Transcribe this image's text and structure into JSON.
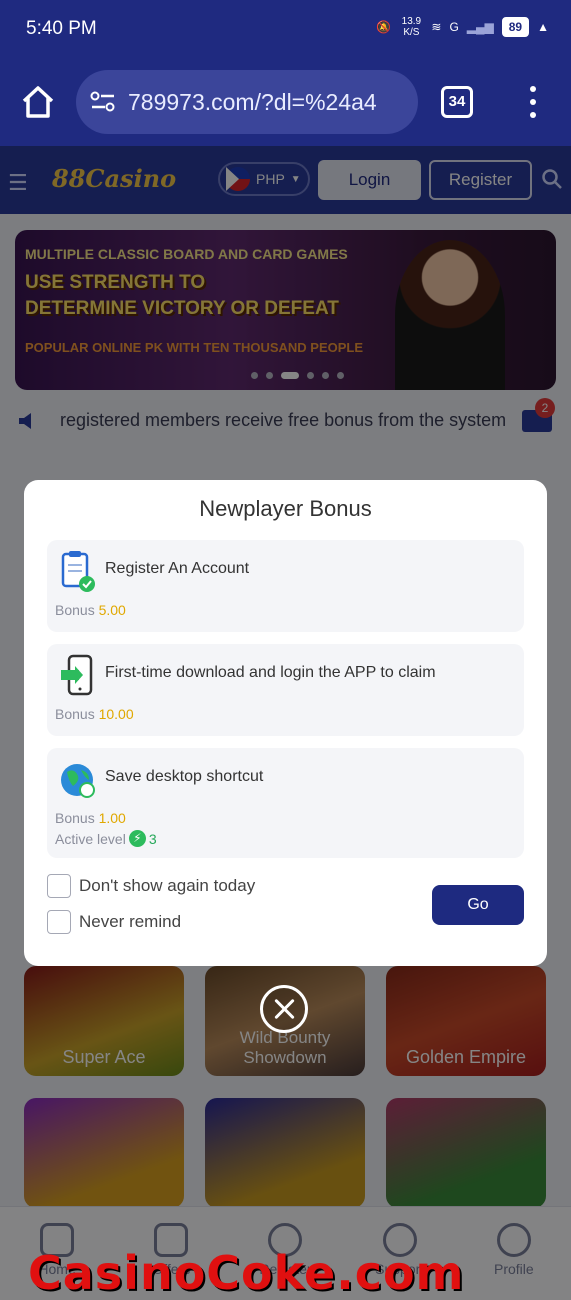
{
  "status_bar": {
    "time": "5:40 PM",
    "net_speed": "13.9 K/S",
    "network": "G",
    "battery": "89"
  },
  "browser": {
    "url": "789973.com/?dl=%24a4",
    "tab_count": "34"
  },
  "site_header": {
    "logo_text": "88Casino",
    "currency": "PHP",
    "login_label": "Login",
    "register_label": "Register"
  },
  "banner": {
    "line1": "MULTIPLE CLASSIC BOARD AND CARD GAMES",
    "line2": "USE STRENGTH TO",
    "line3": "DETERMINE VICTORY OR DEFEAT",
    "line4": "POPULAR ONLINE PK WITH TEN THOUSAND PEOPLE",
    "active_slide": 3,
    "slide_count": 6
  },
  "marquee": {
    "text": "registered members receive free bonus from the system",
    "mail_badge": "2"
  },
  "modal": {
    "title": "Newplayer Bonus",
    "tasks": [
      {
        "name": "Register An Account",
        "bonus_label": "Bonus",
        "bonus_value": "5.00",
        "icon": "clipboard-check-icon"
      },
      {
        "name": "First-time download and login the APP to claim",
        "bonus_label": "Bonus",
        "bonus_value": "10.00",
        "icon": "phone-download-icon"
      },
      {
        "name": "Save desktop shortcut",
        "bonus_label": "Bonus",
        "bonus_value": "1.00",
        "level_label": "Active level",
        "level_value": "3",
        "icon": "globe-link-icon"
      }
    ],
    "checkbox_today": "Don't show again today",
    "checkbox_never": "Never remind",
    "go_label": "Go"
  },
  "games": [
    {
      "name": "Super Ace"
    },
    {
      "name": "Wild Bounty Showdown"
    },
    {
      "name": "Golden Empire"
    }
  ],
  "bottom_nav": [
    "Home",
    "Offers",
    "Register",
    "Support",
    "Profile"
  ],
  "watermark": "CasinoCoke.com",
  "colors": {
    "primary": "#1e2a80",
    "bonus_value": "#e0a800",
    "level": "#26a85a"
  }
}
